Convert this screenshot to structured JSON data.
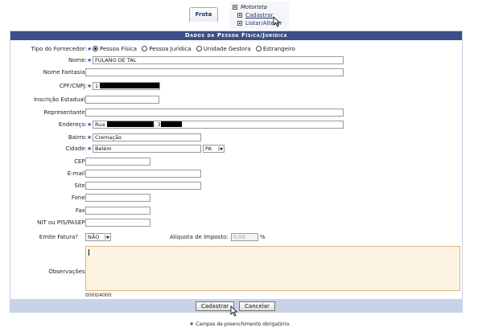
{
  "menu": {
    "tab_label": "Frota",
    "group_label": "Motorista",
    "items": [
      "Cadastrar",
      "Listar/Alterar"
    ]
  },
  "form": {
    "title": "Dados da Pessoa Física/Jurídica",
    "tipo_label": "Tipo do Fornecedor:",
    "tipo_options": [
      "Pessoa Física",
      "Pessoa Jurídica",
      "Unidade Gestora",
      "Estrangeiro"
    ],
    "tipo_selected": "Pessoa Física",
    "fields": {
      "nome": {
        "label": "Nome:",
        "value": "FULANO DE TAL"
      },
      "nome_fantasia": {
        "label": "Nome Fantasia:",
        "value": ""
      },
      "cpf": {
        "label": "CPF/CNPJ:",
        "value": "1"
      },
      "inscricao": {
        "label": "Inscrição Estadual:",
        "value": ""
      },
      "representante": {
        "label": "Representante:",
        "value": ""
      },
      "endereco": {
        "label": "Endereço:",
        "value": "Rua",
        "sep": ", 3"
      },
      "bairro": {
        "label": "Bairro:",
        "value": "Cremação"
      },
      "cidade": {
        "label": "Cidade:",
        "value": "Belém",
        "uf": "PA"
      },
      "cep": {
        "label": "CEP:",
        "value": ""
      },
      "email": {
        "label": "E-mail:",
        "value": ""
      },
      "site": {
        "label": "Site:",
        "value": ""
      },
      "fone": {
        "label": "Fone:",
        "value": ""
      },
      "fax": {
        "label": "Fax:",
        "value": ""
      },
      "nit": {
        "label": "NIT ou PIS/PASEP:",
        "value": ""
      },
      "emite_fatura": {
        "label": "Emite Fatura?",
        "value": "NÃO"
      },
      "aliquota": {
        "label": "Alíquota de Imposto:",
        "value": "0,00",
        "unit": "%"
      },
      "observacoes": {
        "label": "Observações:",
        "value": "",
        "counter": "0000/4000"
      }
    },
    "buttons": {
      "submit": "Cadastrar",
      "cancel": "Cancelar"
    },
    "required_note": "Campos de preenchimento obrigatório."
  },
  "colors": {
    "caption_bg": "#3b4f86",
    "footer_bg": "#c8d3e8",
    "textarea_bg": "#fdf3e2",
    "required_star": "#2a57c8"
  }
}
